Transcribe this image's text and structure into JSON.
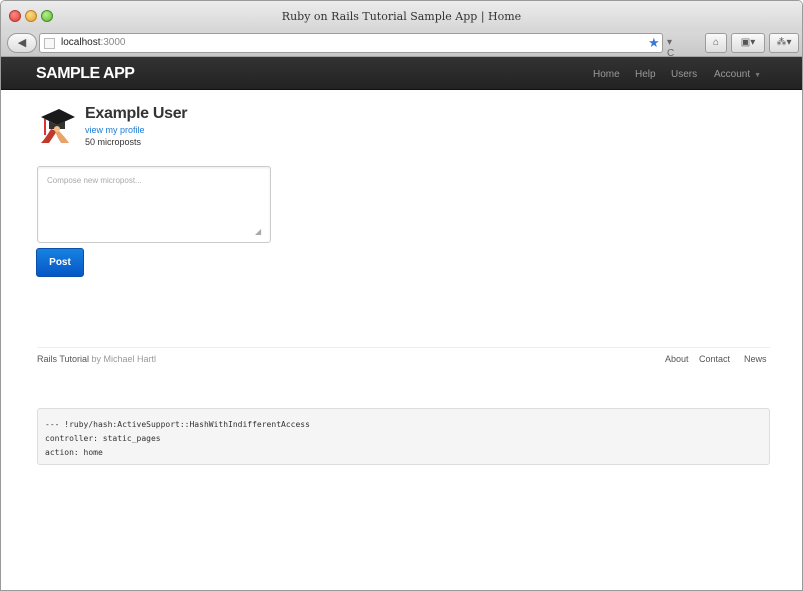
{
  "browser": {
    "window_title": "Ruby on Rails Tutorial Sample App | Home",
    "back_glyph": "◀",
    "url_host": "localhost",
    "url_port": ":3000",
    "star_glyph": "★",
    "reload_glyph": "▾ C",
    "home_glyph": "⌂",
    "bookmarks_glyph": "▣▾",
    "tools_glyph": "⁂▾"
  },
  "navbar": {
    "brand": "SAMPLE APP",
    "links": [
      "Home",
      "Help",
      "Users",
      "Account"
    ],
    "account_caret": "▼"
  },
  "profile": {
    "name": "Example User",
    "profile_link": "view my profile",
    "micropost_count": "50 microposts"
  },
  "compose": {
    "placeholder": "Compose new micropost...",
    "submit_label": "Post"
  },
  "footer": {
    "brand_link": "Rails Tutorial",
    "by_text": " by ",
    "author_link": "Michael Hartl",
    "links": [
      "About",
      "Contact",
      "News"
    ]
  },
  "debug": {
    "lines": [
      "--- !ruby/hash:ActiveSupport::HashWithIndifferentAccess",
      "controller: static_pages",
      "action: home"
    ]
  },
  "colors": {
    "navbar_bg": "#222222",
    "post_button": "#0656c6",
    "link": "#1a7bd6"
  }
}
